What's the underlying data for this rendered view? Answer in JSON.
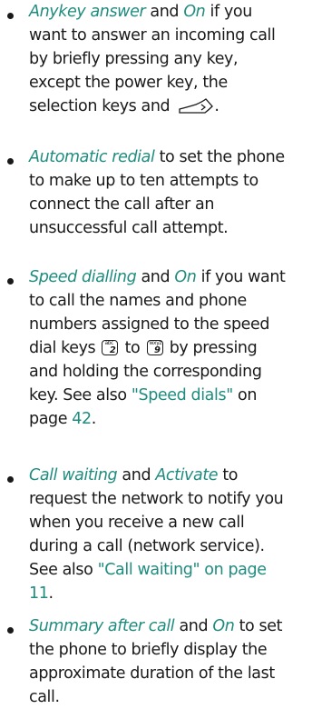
{
  "items": [
    {
      "lines": [
        [
          {
            "t": "Anykey answer",
            "s": "hl"
          },
          {
            "t": " and "
          },
          {
            "t": "On",
            "s": "hl"
          },
          {
            "t": " if you"
          }
        ],
        [
          {
            "t": "want to answer an incoming call"
          }
        ],
        [
          {
            "t": "by briefly pressing any key,"
          }
        ],
        [
          {
            "t": "except the power key, the"
          }
        ],
        [
          {
            "t": "selection keys and "
          },
          {
            "icon": "end-key-icon"
          },
          {
            "t": "."
          }
        ]
      ]
    },
    {
      "lines": [
        [
          {
            "t": "Automatic redial",
            "s": "hl"
          },
          {
            "t": " to set the phone"
          }
        ],
        [
          {
            "t": "to make up to ten attempts to"
          }
        ],
        [
          {
            "t": "connect the call after an"
          }
        ],
        [
          {
            "t": "unsuccessful call attempt."
          }
        ]
      ]
    },
    {
      "lines": [
        [
          {
            "t": "Speed dialling",
            "s": "hl"
          },
          {
            "t": " and "
          },
          {
            "t": "On",
            "s": "hl"
          },
          {
            "t": " if you want"
          }
        ],
        [
          {
            "t": "to call the names and phone"
          }
        ],
        [
          {
            "t": "numbers assigned to the speed"
          }
        ],
        [
          {
            "t": "dial keys "
          },
          {
            "key": "2",
            "sub": "abc"
          },
          {
            "t": " to "
          },
          {
            "key": "9",
            "sub": "wxyz"
          },
          {
            "t": " by pressing"
          }
        ],
        [
          {
            "t": "and holding the corresponding"
          }
        ],
        [
          {
            "t": "key. See also "
          },
          {
            "t": "\"Speed dials\"",
            "s": "ln"
          },
          {
            "t": " on"
          }
        ],
        [
          {
            "t": "page "
          },
          {
            "t": "42",
            "s": "ln"
          },
          {
            "t": "."
          }
        ]
      ]
    },
    {
      "lines": [
        [
          {
            "t": "Call waiting",
            "s": "hl"
          },
          {
            "t": " and "
          },
          {
            "t": "Activate",
            "s": "hl"
          },
          {
            "t": " to"
          }
        ],
        [
          {
            "t": "request the network to notify you"
          }
        ],
        [
          {
            "t": "when you receive a new call"
          }
        ],
        [
          {
            "t": "during a call (network service)."
          }
        ],
        [
          {
            "t": "See also "
          },
          {
            "t": "\"Call waiting\" on page",
            "s": "ln"
          }
        ],
        [
          {
            "t": "11",
            "s": "ln"
          },
          {
            "t": "."
          }
        ]
      ]
    },
    {
      "lines": [
        [
          {
            "t": "Summary after call",
            "s": "hl"
          },
          {
            "t": " and "
          },
          {
            "t": "On",
            "s": "hl"
          },
          {
            "t": " to set"
          }
        ],
        [
          {
            "t": "the phone to briefly display the"
          }
        ],
        [
          {
            "t": "approximate duration of the last"
          }
        ],
        [
          {
            "t": "call."
          }
        ]
      ]
    }
  ]
}
